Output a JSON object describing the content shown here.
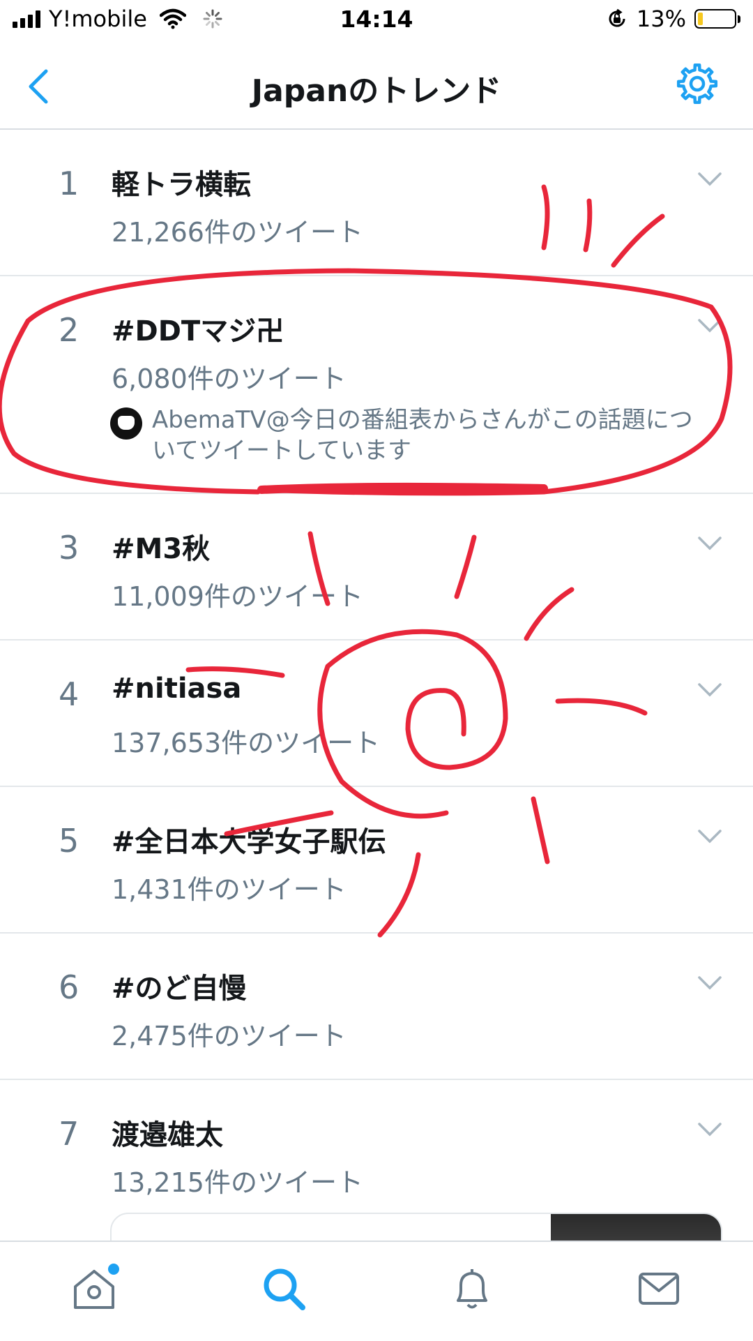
{
  "status_bar": {
    "carrier": "Y!mobile",
    "time": "14:14",
    "battery_percent": "13%",
    "battery_level": 0.13
  },
  "header": {
    "title": "Japanのトレンド",
    "back_icon": "chevron-left-icon",
    "settings_icon": "gear-icon"
  },
  "trends": [
    {
      "rank": "1",
      "name": "軽トラ横転",
      "count": "21,266件のツイート"
    },
    {
      "rank": "2",
      "name": "#DDTマジ卍",
      "count": "6,080件のツイート",
      "context": "AbemaTV@今日の番組表からさんがこの話題についてツイートしています"
    },
    {
      "rank": "3",
      "name": "#M3秋",
      "count": "11,009件のツイート"
    },
    {
      "rank": "4",
      "name": "#nitiasa",
      "count": "137,653件のツイート"
    },
    {
      "rank": "5",
      "name": "#全日本大学女子駅伝",
      "count": "1,431件のツイート"
    },
    {
      "rank": "6",
      "name": "#のど自慢",
      "count": "2,475件のツイート"
    },
    {
      "rank": "7",
      "name": "渡邉雄太",
      "count": "13,215件のツイート"
    }
  ],
  "tab_bar": {
    "tabs": [
      "home-icon",
      "search-icon",
      "bell-icon",
      "mail-icon"
    ],
    "active": "search-icon"
  },
  "colors": {
    "accent": "#1da1f2",
    "annotation": "#e8263a",
    "secondary_text": "#657786"
  }
}
